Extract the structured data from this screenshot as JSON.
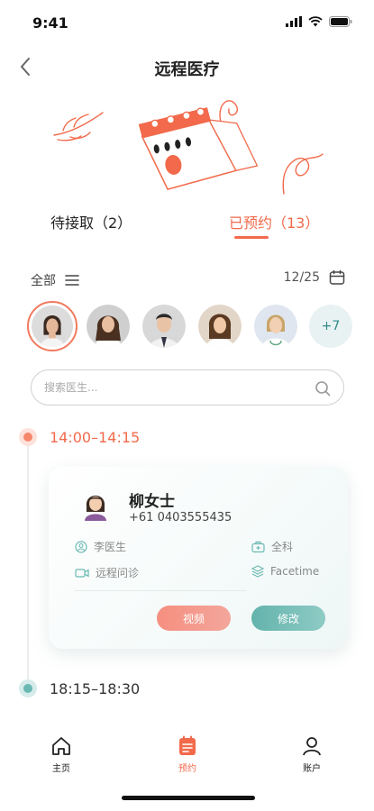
{
  "status_bar": {
    "time": "9:41"
  },
  "header": {
    "title": "远程医疗"
  },
  "tabs": [
    {
      "label": "待接取（2）",
      "active": false
    },
    {
      "label": "已预约（13）",
      "active": true
    }
  ],
  "filter": {
    "all_label": "全部",
    "date": "12/25"
  },
  "doctors": {
    "more_label": "+7"
  },
  "search": {
    "placeholder": "搜索医生..."
  },
  "appointments": [
    {
      "time": "14:00–14:15",
      "patient_name": "柳女士",
      "phone": "+61 0403555435",
      "doctor": "李医生",
      "department": "全科",
      "type": "远程问诊",
      "platform": "Facetime",
      "video_label": "视频",
      "edit_label": "修改"
    },
    {
      "time": "18:15–18:30"
    }
  ],
  "bottom_nav": [
    {
      "label": "主页",
      "icon": "home-icon"
    },
    {
      "label": "预约",
      "icon": "calendar-icon",
      "active": true
    },
    {
      "label": "账户",
      "icon": "user-icon"
    }
  ],
  "colors": {
    "accent": "#f26a4b",
    "teal": "#6ab8b2"
  }
}
